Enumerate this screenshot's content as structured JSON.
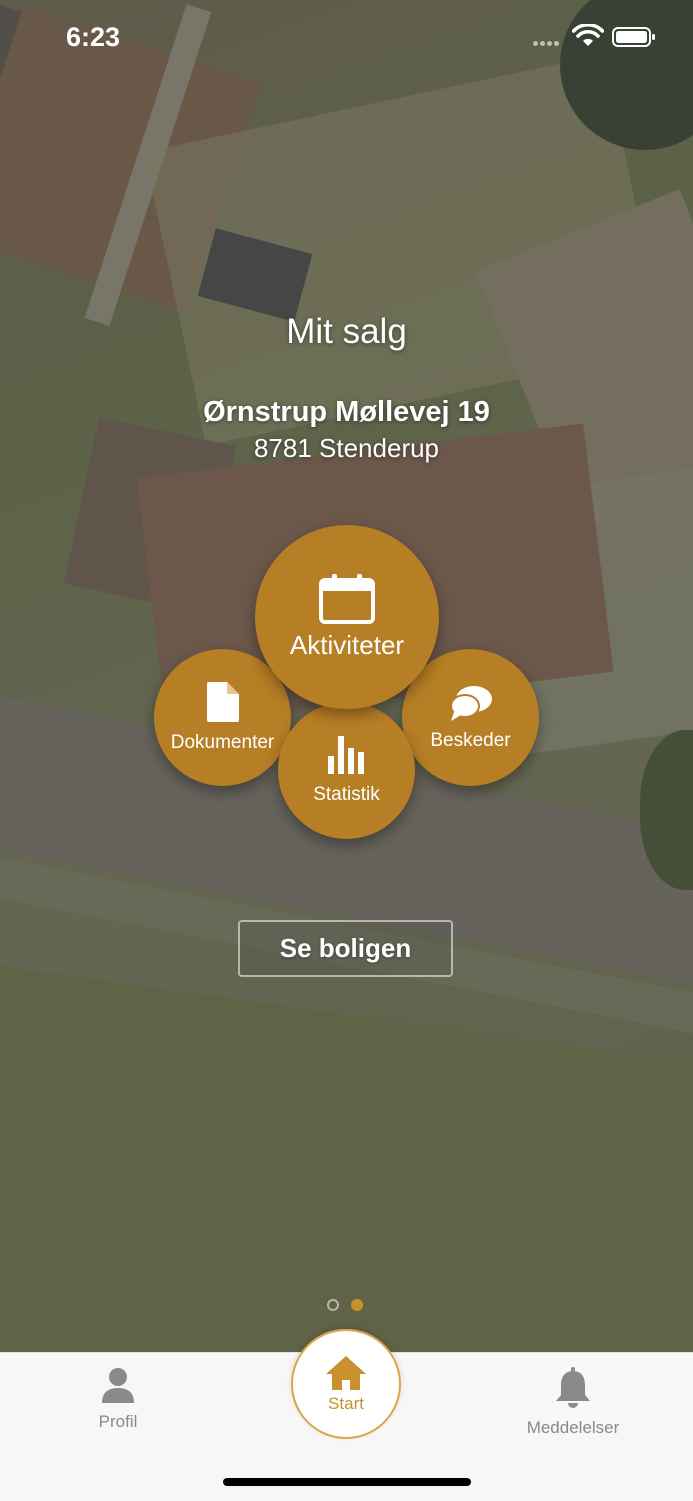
{
  "status_bar": {
    "time": "6:23"
  },
  "header": {
    "title": "Mit salg"
  },
  "property": {
    "street": "Ørnstrup Møllevej 19",
    "city": "8781 Stenderup"
  },
  "menu": {
    "aktiviteter": "Aktiviteter",
    "dokumenter": "Dokumenter",
    "beskeder": "Beskeder",
    "statistik": "Statistik"
  },
  "actions": {
    "see_home": "Se boligen"
  },
  "pager": {
    "pages": 2,
    "active": 2
  },
  "tabs": {
    "profil": "Profil",
    "start": "Start",
    "meddelelser": "Meddelelser"
  },
  "colors": {
    "accent": "#b67e25",
    "active_tab": "#c7922e"
  }
}
